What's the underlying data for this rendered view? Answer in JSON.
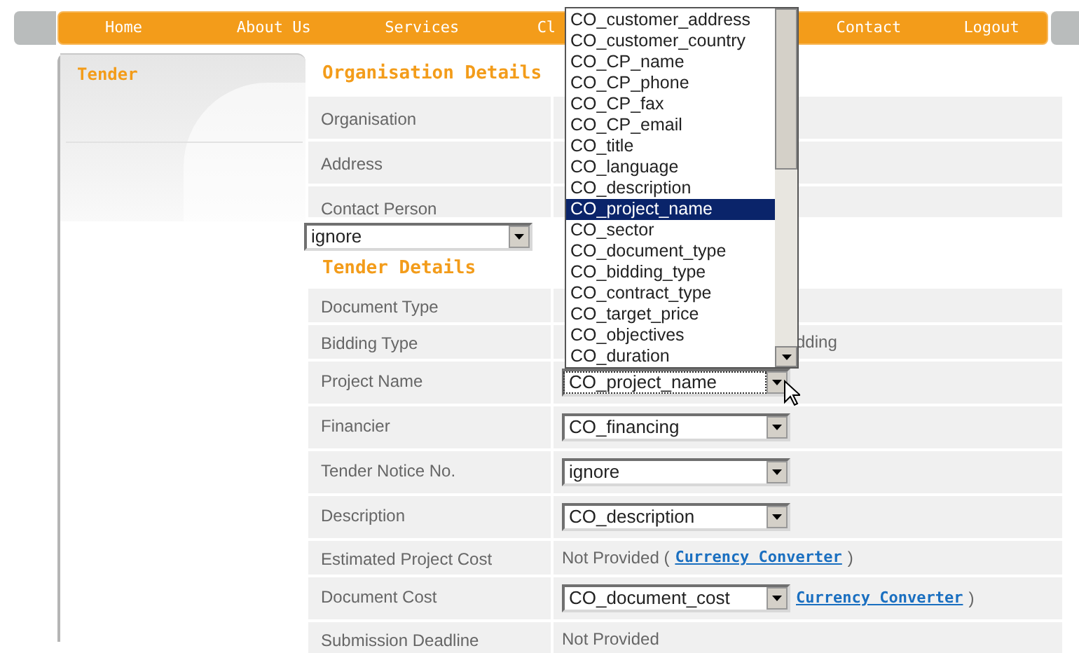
{
  "nav": [
    {
      "label": "Home"
    },
    {
      "label": "About Us"
    },
    {
      "label": "Services"
    },
    {
      "label": "Cl"
    },
    {
      "label": "Contact"
    },
    {
      "label": "Logout"
    }
  ],
  "sidebar": {
    "title": "Tender"
  },
  "organisation": {
    "title": "Organisation Details",
    "rows": [
      {
        "label": "Organisation"
      },
      {
        "label": "Address"
      },
      {
        "label": "Contact Person"
      }
    ],
    "select": {
      "value": "ignore"
    }
  },
  "tender": {
    "title": "Tender Details",
    "rows": [
      {
        "label": "Document Type",
        "kind": "empty"
      },
      {
        "label": "Bidding Type",
        "kind": "text",
        "value": "dding"
      },
      {
        "label": "Project Name",
        "kind": "select",
        "value": "CO_project_name",
        "focused": true
      },
      {
        "label": "Financier",
        "kind": "select",
        "value": "CO_financing",
        "focused": false
      },
      {
        "label": "Tender Notice No.",
        "kind": "select",
        "value": "ignore",
        "focused": false
      },
      {
        "label": "Description",
        "kind": "select",
        "value": "CO_description",
        "focused": false
      },
      {
        "label": "Estimated Project Cost",
        "kind": "text_link",
        "value": "Not Provided (",
        "link": "Currency Converter",
        "after": ")"
      },
      {
        "label": "Document Cost",
        "kind": "select_link",
        "value": "CO_document_cost",
        "focused": false,
        "link": "Currency Converter",
        "after": ")"
      },
      {
        "label": "Submission Deadline",
        "kind": "text",
        "value": "Not Provided"
      }
    ]
  },
  "dropdown_list": {
    "options": [
      {
        "label": "CO_customer_address",
        "selected": false
      },
      {
        "label": "CO_customer_country",
        "selected": false
      },
      {
        "label": "CO_CP_name",
        "selected": false
      },
      {
        "label": "CO_CP_phone",
        "selected": false
      },
      {
        "label": "CO_CP_fax",
        "selected": false
      },
      {
        "label": "CO_CP_email",
        "selected": false
      },
      {
        "label": "CO_title",
        "selected": false
      },
      {
        "label": "CO_language",
        "selected": false
      },
      {
        "label": "CO_description",
        "selected": false
      },
      {
        "label": "CO_project_name",
        "selected": true
      },
      {
        "label": "CO_sector",
        "selected": false
      },
      {
        "label": "CO_document_type",
        "selected": false
      },
      {
        "label": "CO_bidding_type",
        "selected": false
      },
      {
        "label": "CO_contract_type",
        "selected": false
      },
      {
        "label": "CO_target_price",
        "selected": false
      },
      {
        "label": "CO_objectives",
        "selected": false
      },
      {
        "label": "CO_duration",
        "selected": false
      }
    ]
  }
}
